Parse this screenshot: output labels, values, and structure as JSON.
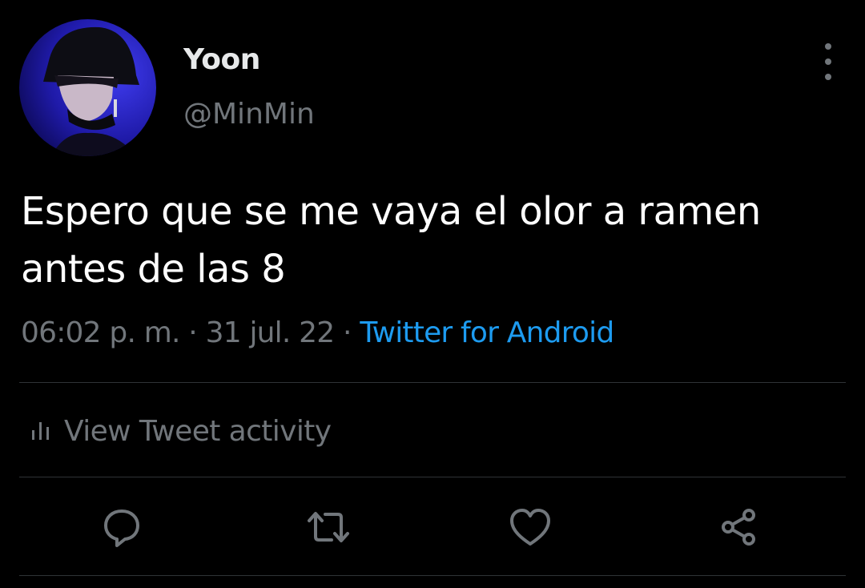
{
  "author": {
    "display_name": "Yoon",
    "handle": "@MinMin",
    "avatar": "avatar-photo"
  },
  "tweet": {
    "text_line1": "Espero que se me vaya el olor a ramen",
    "text_line2": "antes de las 8",
    "time": "06:02 p. m.",
    "separator": "·",
    "date": "31 jul. 22",
    "source": "Twitter for Android"
  },
  "activity": {
    "label": "View Tweet activity",
    "icon": "bar-chart-icon"
  },
  "actions": [
    {
      "name": "reply",
      "icon": "reply-icon"
    },
    {
      "name": "retweet",
      "icon": "retweet-icon"
    },
    {
      "name": "like",
      "icon": "heart-icon"
    },
    {
      "name": "share",
      "icon": "share-icon"
    }
  ],
  "colors": {
    "background": "#000000",
    "primary_text": "#e7e9ea",
    "secondary_text": "#71767b",
    "link": "#1d9bf0",
    "divider": "#2f3336"
  }
}
